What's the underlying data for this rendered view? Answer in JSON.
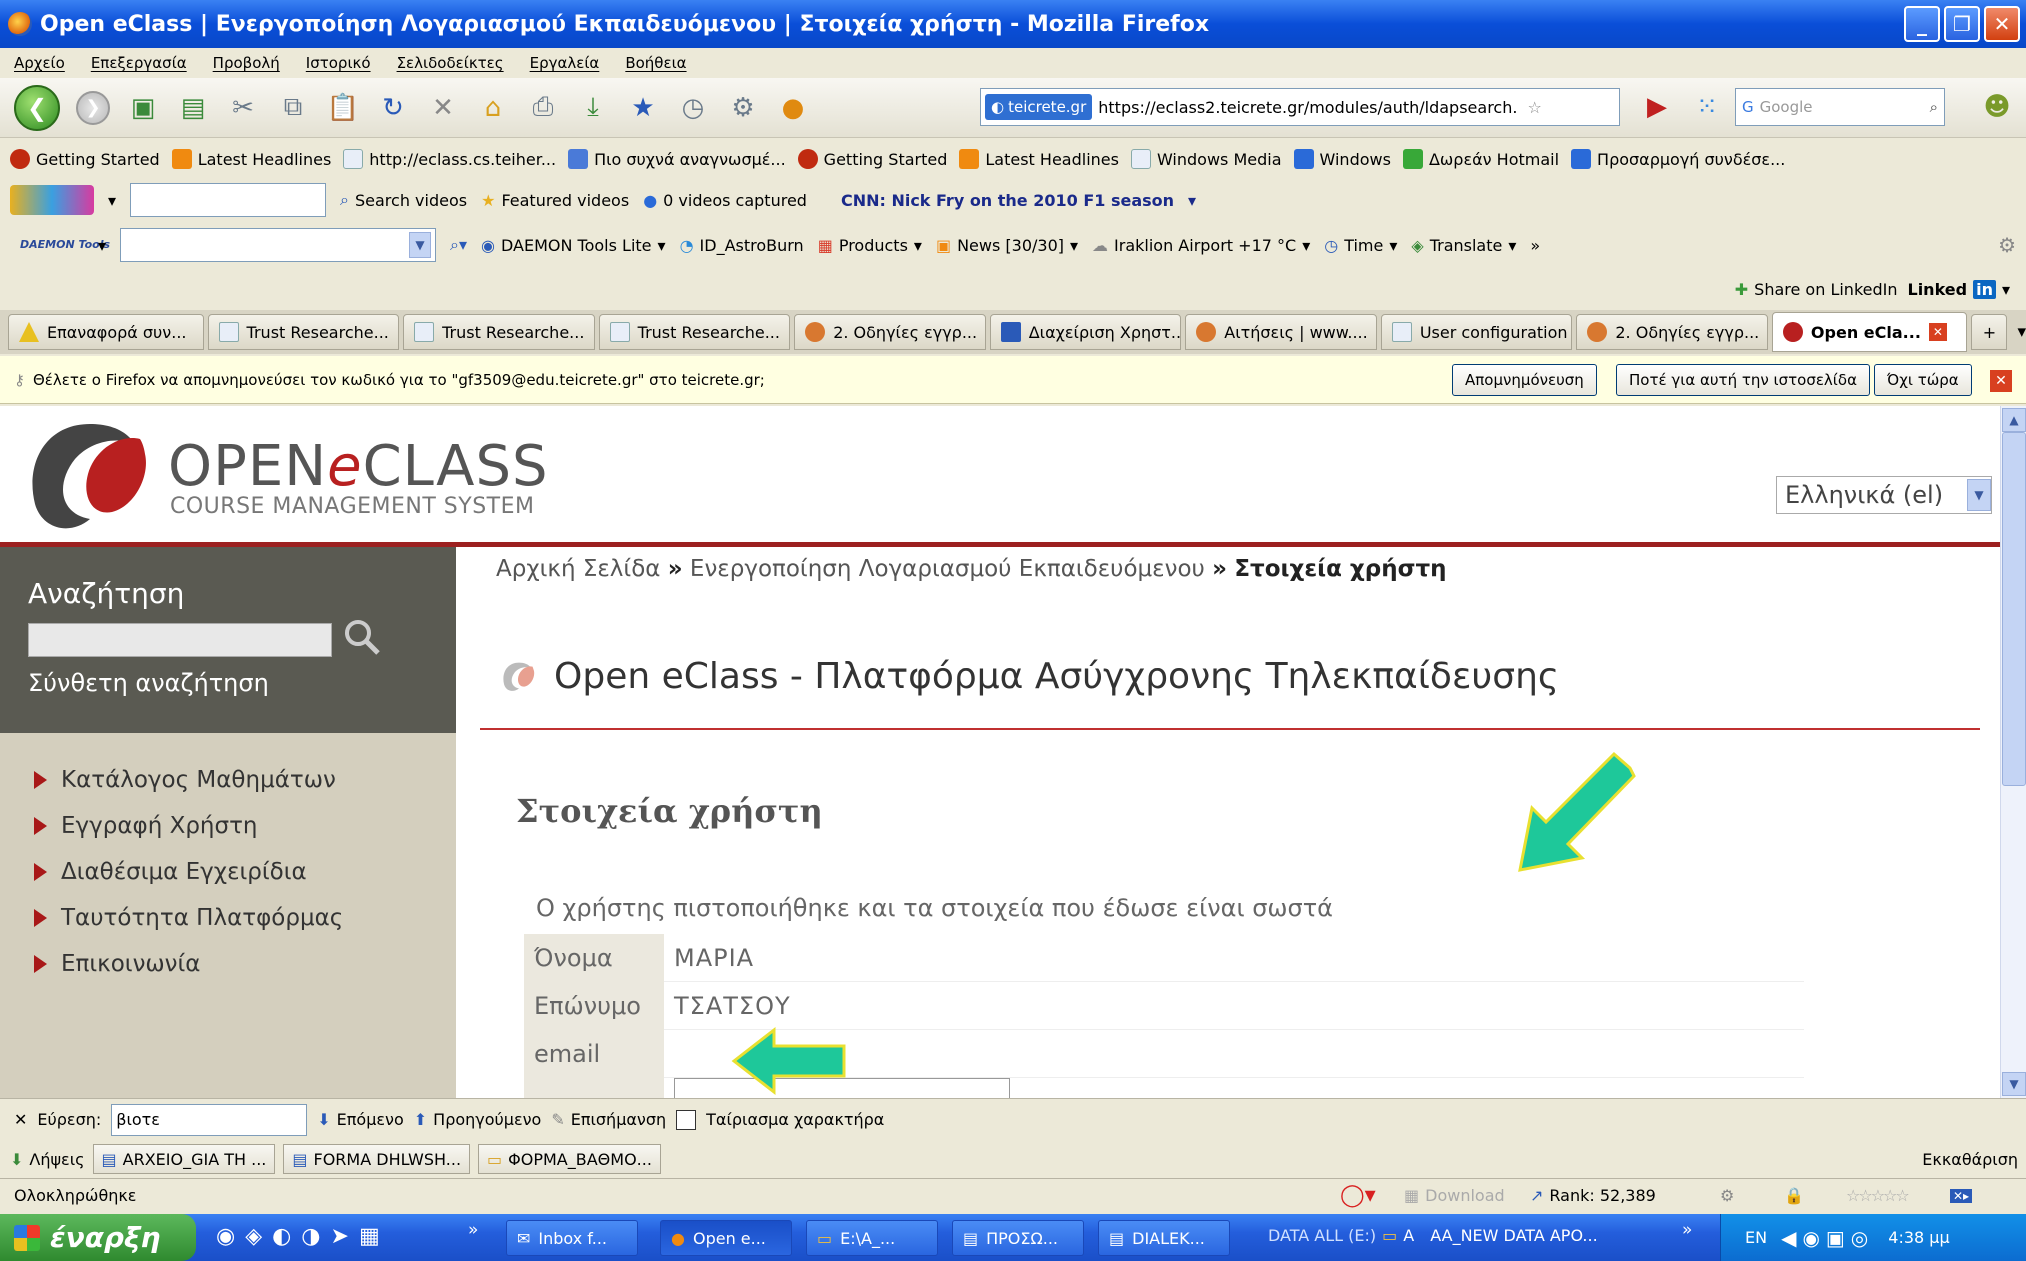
{
  "window": {
    "title": "Open eClass | Ενεργοποίηση Λογαριασμού Εκπαιδευόμενου | Στοιχεία χρήστη - Mozilla Firefox"
  },
  "menu": [
    "Αρχείο",
    "Επεξεργασία",
    "Προβολή",
    "Ιστορικό",
    "Σελιδοδείκτες",
    "Εργαλεία",
    "Βοήθεια"
  ],
  "nav": {
    "site_badge": "teicrete.gr",
    "url": "https://eclass2.teicrete.gr/modules/auth/ldapsearch.",
    "search_placeholder": "Google"
  },
  "bookmarks": [
    {
      "label": "Getting Started",
      "icon": "firefox-icon",
      "color": "#c02a10"
    },
    {
      "label": "Latest Headlines",
      "icon": "rss-icon",
      "color": "#f08a10"
    },
    {
      "label": "http://eclass.cs.teiher...",
      "icon": "page-icon",
      "color": "#e8eef8"
    },
    {
      "label": "Πιο συχνά αναγνωσμέ...",
      "icon": "folder-icon",
      "color": "#4a7ad8"
    },
    {
      "label": "Getting Started",
      "icon": "firefox-icon",
      "color": "#c02a10"
    },
    {
      "label": "Latest Headlines",
      "icon": "rss-icon",
      "color": "#f08a10"
    },
    {
      "label": "Windows Media",
      "icon": "page-icon",
      "color": "#e8eef8"
    },
    {
      "label": "Windows",
      "icon": "msn-icon",
      "color": "#2a6ad8"
    },
    {
      "label": "Δωρεάν Hotmail",
      "icon": "windows-icon",
      "color": "#38a838"
    },
    {
      "label": "Προσαρμογή συνδέσε...",
      "icon": "msn-icon",
      "color": "#2a6ad8"
    }
  ],
  "toolbar1": {
    "search_videos": "Search videos",
    "featured_videos": "Featured videos",
    "videos_captured": "0 videos captured",
    "news_ticker": "CNN: Nick Fry on the 2010 F1 season"
  },
  "toolbar2": {
    "brand": "DAEMON Tools",
    "items": [
      "DAEMON Tools Lite",
      "ID_AstroBurn",
      "Products",
      "News [30/30]",
      "Iraklion Airport +17 °C",
      "Time",
      "Translate",
      "»"
    ]
  },
  "linkedin": {
    "share": "Share on LinkedIn",
    "brand": "Linked"
  },
  "tabs": [
    {
      "label": "Επαναφορά συν...",
      "color": "#e8c020"
    },
    {
      "label": "Trust Researche...",
      "color": "#e8eef8"
    },
    {
      "label": "Trust Researche...",
      "color": "#e8eef8"
    },
    {
      "label": "Trust Researche...",
      "color": "#e8eef8"
    },
    {
      "label": "2. Οδηγίες εγγρ...",
      "color": "#d87830"
    },
    {
      "label": "Διαχείριση Χρηστ...",
      "color": "#2a5ab8"
    },
    {
      "label": "Αιτήσεις | www....",
      "color": "#d87830"
    },
    {
      "label": "User configuration",
      "color": "#e8eef8"
    },
    {
      "label": "2. Οδηγίες εγγρ...",
      "color": "#d87830"
    },
    {
      "label": "Open eCla...",
      "color": "#b82020",
      "active": true
    }
  ],
  "password_bar": {
    "message": "Θέλετε ο Firefox να απομνημονεύσει τον κωδικό για το \"gf3509@edu.teicrete.gr\" στο teicrete.gr;",
    "remember": "Απομνημόνευση",
    "never": "Ποτέ για αυτή την ιστοσελίδα",
    "not_now": "Όχι τώρα"
  },
  "site": {
    "logo_open": "OPEN",
    "logo_e": "e",
    "logo_class": "CLASS",
    "logo_sub": "COURSE MANAGEMENT SYSTEM",
    "language": "Ελληνικά (el)",
    "search_title": "Αναζήτηση",
    "advanced_search": "Σύνθετη αναζήτηση",
    "sidebar_menu": [
      "Κατάλογος Μαθημάτων",
      "Εγγραφή Χρήστη",
      "Διαθέσιμα Εγχειρίδια",
      "Ταυτότητα Πλατφόρμας",
      "Επικοινωνία"
    ],
    "breadcrumb": {
      "home": "Αρχική Σελίδα",
      "sep": "»",
      "activation": "Ενεργοποίηση Λογαριασμού Εκπαιδευόμενου",
      "current": "Στοιχεία χρήστη"
    },
    "page_title": "Open eClass - Πλατφόρμα Ασύγχρονης Τηλεκπαίδευσης",
    "section_title": "Στοιχεία χρήστη",
    "status_message": "Ο χρήστης πιστοποιήθηκε και τα στοιχεία που έδωσε είναι σωστά",
    "fields": [
      {
        "label": "Όνομα",
        "value": "ΜΑΡΙΑ"
      },
      {
        "label": "Επώνυμο",
        "value": "ΤΣΑΤΣΟΥ"
      },
      {
        "label": "email",
        "value": ""
      }
    ]
  },
  "findbar": {
    "label": "Εύρεση:",
    "query": "βιοτε",
    "next": "Επόμενο",
    "previous": "Προηγούμενο",
    "highlight": "Επισήμανση",
    "match_case": "Ταίριασμα χαρακτήρα"
  },
  "downloads": {
    "items": [
      "Λήψεις",
      "ARXEIO_GIA TH ...",
      "FORMA DHLWSH...",
      "ΦΟΡΜΑ_ΒΑΘΜΟ..."
    ],
    "clear": "Εκκαθάριση"
  },
  "status": {
    "text": "Ολοκληρώθηκε",
    "download": "Download",
    "rank": "Rank: 52,389"
  },
  "taskbar": {
    "start": "έναρξη",
    "items": [
      "Inbox f...",
      "Open e...",
      "E:\\A_...",
      "ΠΡΟΣΩ...",
      "DIALEK..."
    ],
    "drive": "DATA ALL (E:)",
    "folder_a": "A",
    "folder_b": "AA_NEW DATA APO...",
    "lang": "EN",
    "clock": "4:38 μμ"
  }
}
